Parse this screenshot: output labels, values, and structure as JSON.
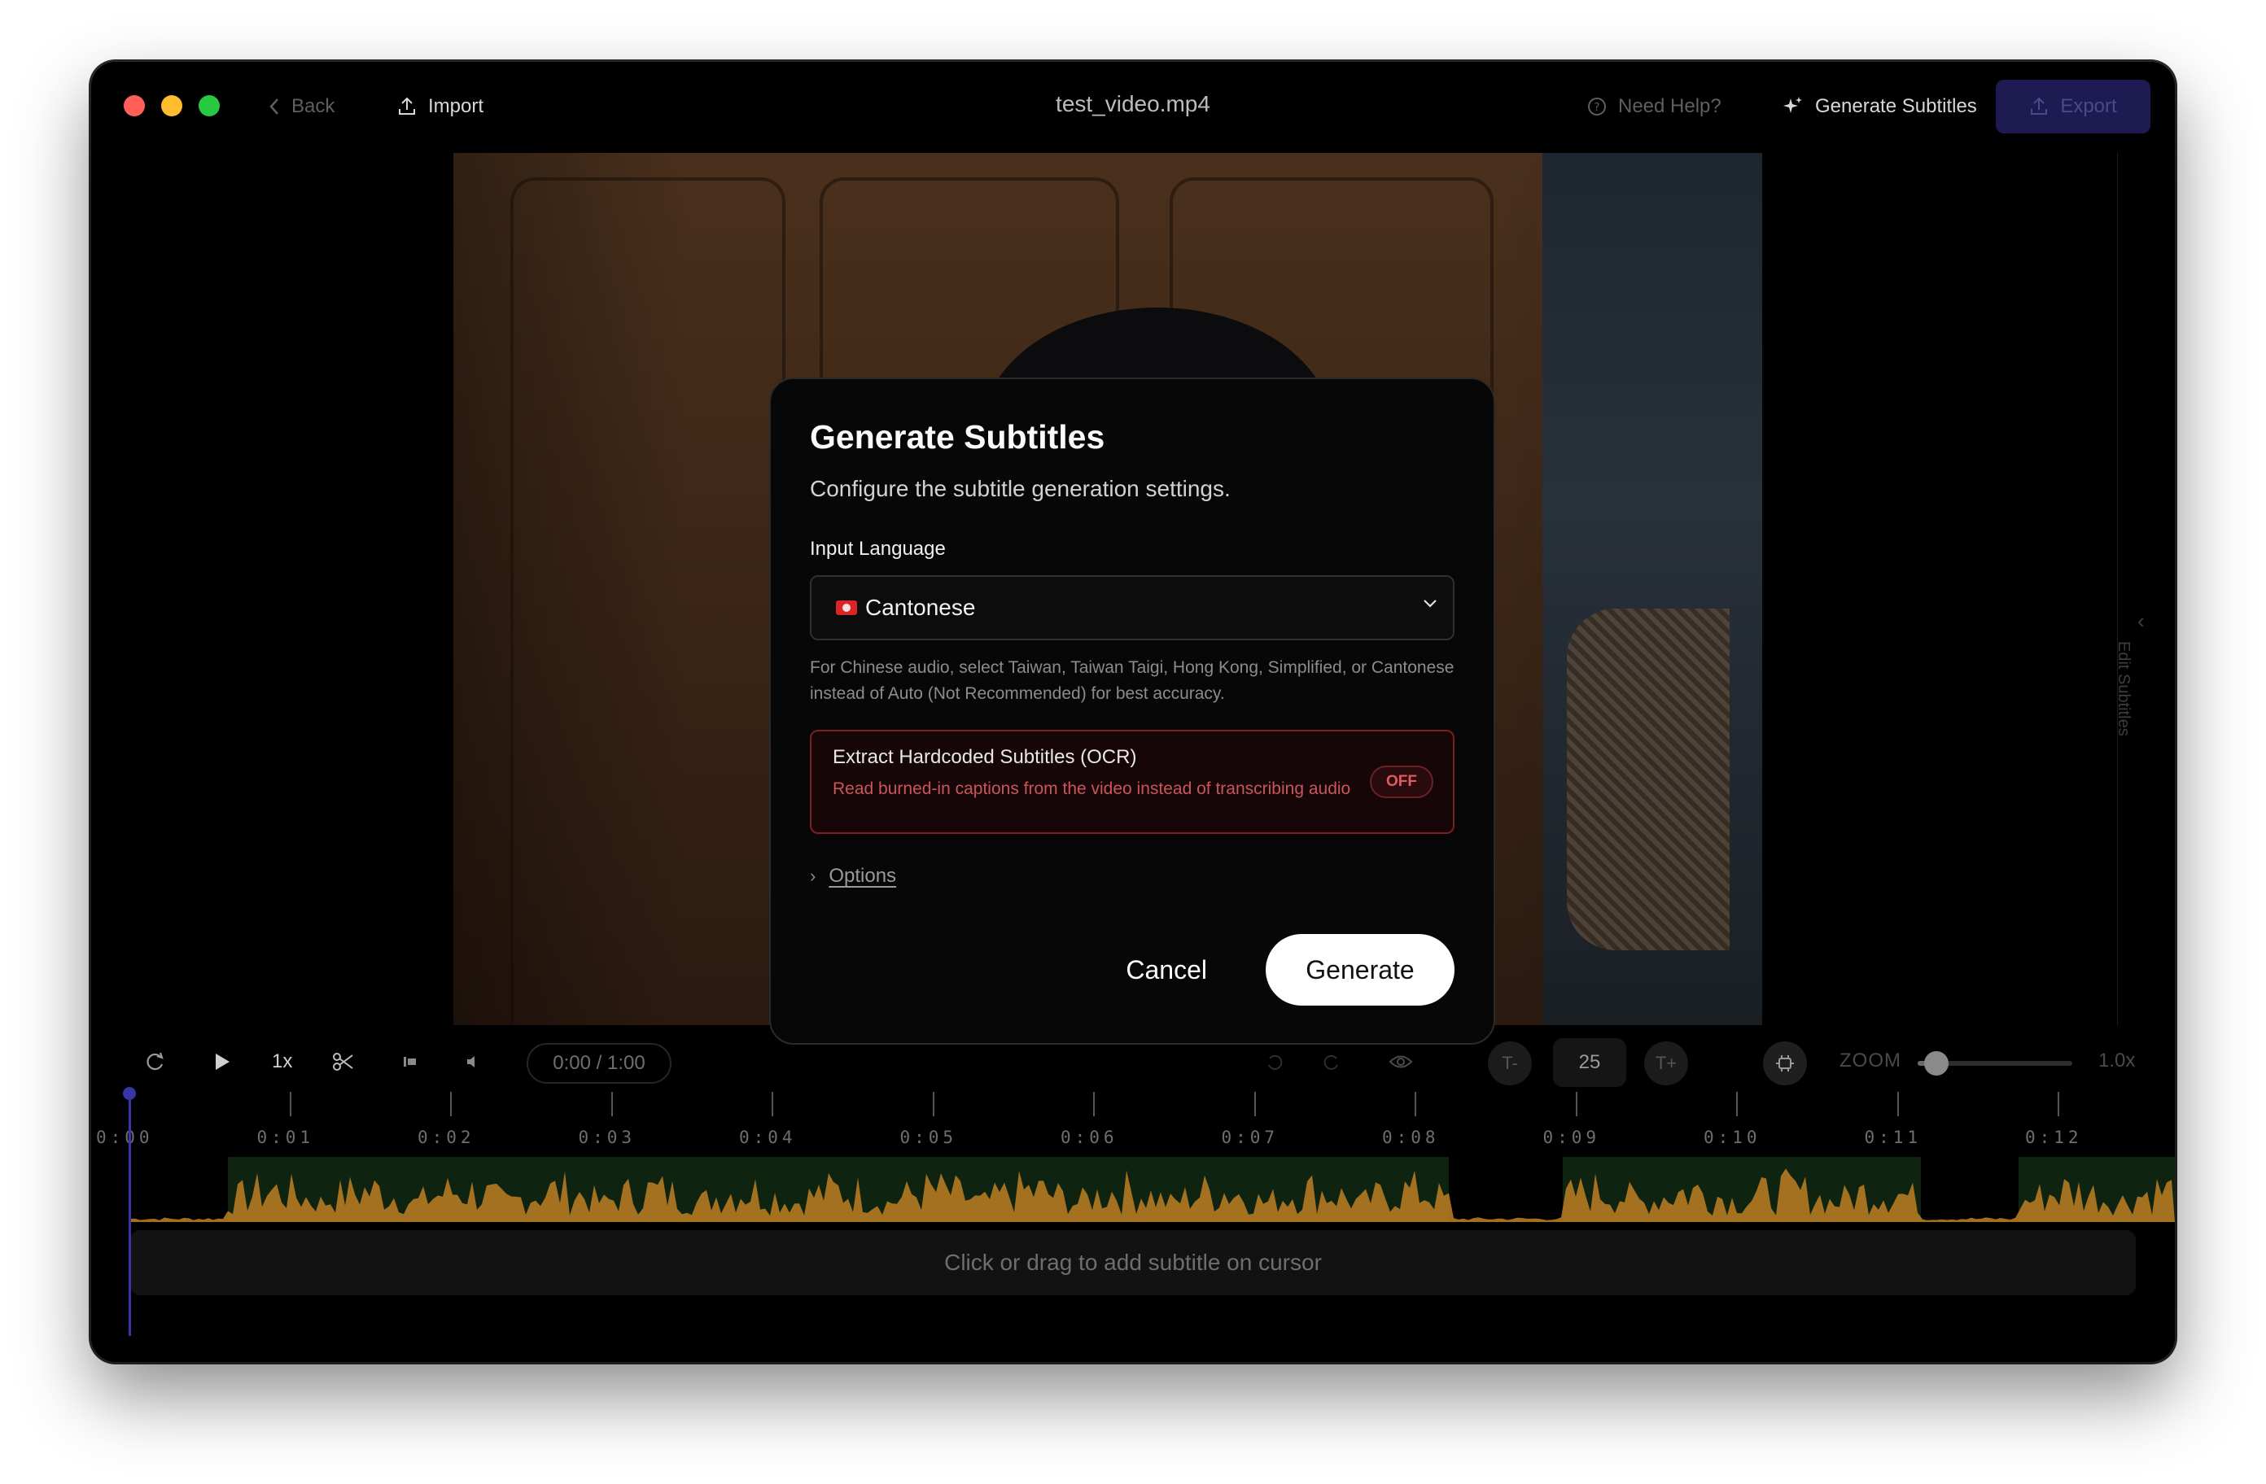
{
  "window": {
    "title": "test_video.mp4",
    "back_label": "Back",
    "import_label": "Import",
    "help_label": "Need Help?",
    "generate_label": "Generate Subtitles",
    "export_label": "Export",
    "side_panel_label": "Edit Subtitles"
  },
  "modal": {
    "title": "Generate Subtitles",
    "description": "Configure the subtitle generation settings.",
    "language_label": "Input Language",
    "language_value": "Cantonese",
    "language_flag": "hong-kong-flag",
    "hint": "For Chinese audio, select Taiwan, Taiwan Taigi, Hong Kong, Simplified, or Cantonese instead of Auto (Not Recommended) for best accuracy.",
    "ocr_title": "Extract Hardcoded Subtitles (OCR)",
    "ocr_description": "Read burned-in captions from the video instead of transcribing audio",
    "ocr_toggle": "OFF",
    "options_label": "Options",
    "cancel_label": "Cancel",
    "generate_label": "Generate"
  },
  "controls": {
    "speed": "1x",
    "time": "0:00 / 1:00",
    "font_decrease": "T-",
    "font_size": "25",
    "font_increase": "T+",
    "zoom_label": "ZOOM",
    "zoom_value": "1.0x",
    "zoom_level": 0.12
  },
  "timeline": {
    "ticks": [
      "0:00",
      "0:01",
      "0:02",
      "0:03",
      "0:04",
      "0:05",
      "0:06",
      "0:07",
      "0:08",
      "0:09",
      "0:10",
      "0:11",
      "0:12"
    ],
    "add_hint": "Click or drag to add subtitle on cursor"
  },
  "colors": {
    "waveform": "#b57a22",
    "voice_region": "#0f2410",
    "accent": "#3a36a8",
    "export_bg": "#1d1b52"
  }
}
